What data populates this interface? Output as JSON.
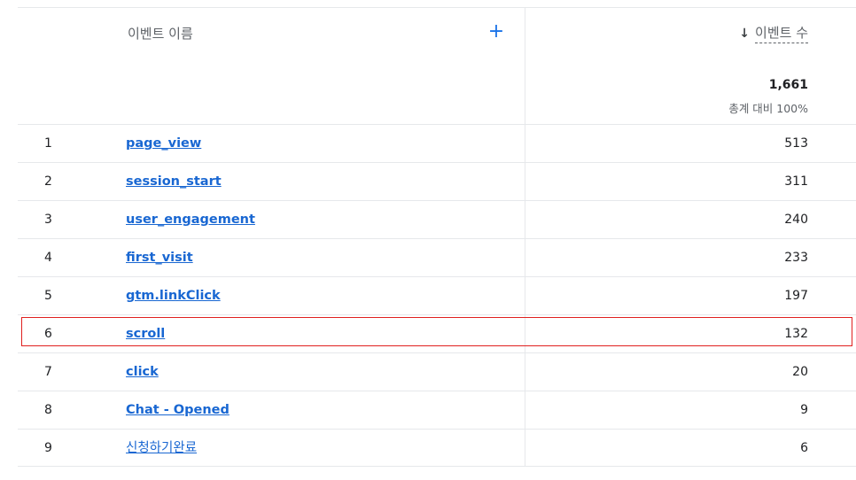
{
  "header": {
    "dimension_label": "이벤트 이름",
    "add_symbol": "+",
    "metric_label": "이벤트 수",
    "sort_arrow": "↓",
    "total_value": "1,661",
    "total_sub": "총계 대비 100%"
  },
  "rows": [
    {
      "index": "1",
      "name": "page_view",
      "count": "513"
    },
    {
      "index": "2",
      "name": "session_start",
      "count": "311"
    },
    {
      "index": "3",
      "name": "user_engagement",
      "count": "240"
    },
    {
      "index": "4",
      "name": "first_visit",
      "count": "233"
    },
    {
      "index": "5",
      "name": "gtm.linkClick",
      "count": "197"
    },
    {
      "index": "6",
      "name": "scroll",
      "count": "132"
    },
    {
      "index": "7",
      "name": "click",
      "count": "20"
    },
    {
      "index": "8",
      "name": "Chat - Opened",
      "count": "9"
    },
    {
      "index": "9",
      "name": "신청하기완료",
      "count": "6"
    }
  ],
  "colors": {
    "link": "#1967d2",
    "accent": "#1a73e8",
    "highlight_border": "#e0201f"
  }
}
